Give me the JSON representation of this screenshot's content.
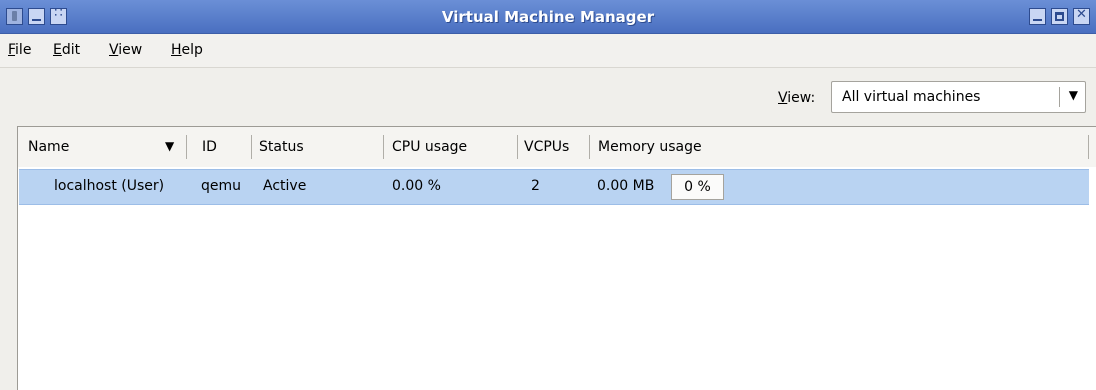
{
  "window": {
    "title": "Virtual Machine Manager"
  },
  "menu": {
    "file": "File",
    "edit": "Edit",
    "view": "View",
    "help": "Help"
  },
  "toolbar": {
    "view_label": "View:",
    "view_selected": "All virtual machines"
  },
  "columns": {
    "name": "Name",
    "id": "ID",
    "status": "Status",
    "cpu": "CPU usage",
    "vcpus": "VCPUs",
    "memory": "Memory usage"
  },
  "rows": [
    {
      "name": "localhost (User)",
      "id": "qemu",
      "status": "Active",
      "cpu": "0.00 %",
      "vcpus": "2",
      "memory": "0.00 MB",
      "memory_percent": "0 %"
    }
  ],
  "icons": {
    "window_menu": "pin-icon",
    "minimize": "minimize-icon",
    "maximize": "maximize-icon",
    "close": "close-icon"
  },
  "colors": {
    "titlebar": "#5a7fcc",
    "selection": "#b9d3f2"
  }
}
